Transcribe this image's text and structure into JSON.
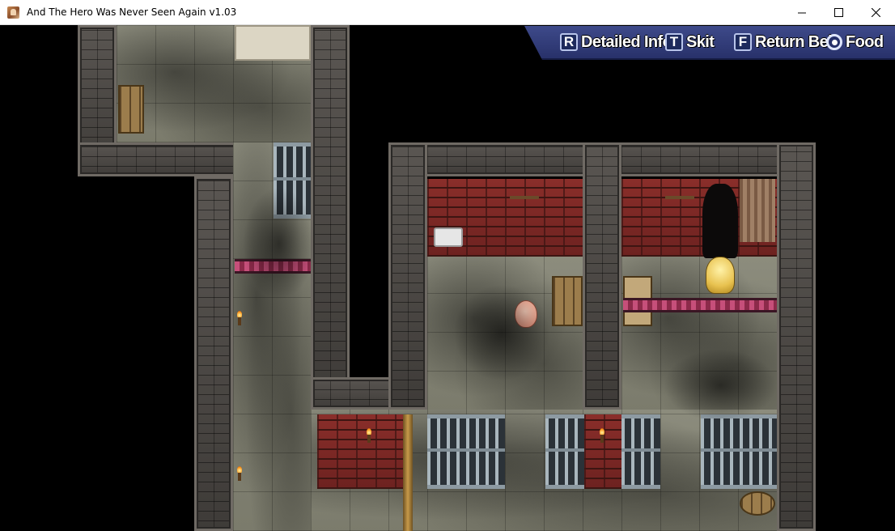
{
  "window": {
    "title": "And The Hero Was Never Seen Again v1.03",
    "controls": [
      "minimize",
      "maximize",
      "close"
    ]
  },
  "hud": {
    "items": [
      {
        "key": "R",
        "label": "Detailed Info"
      },
      {
        "key": "T",
        "label": "Skit"
      },
      {
        "key": "F",
        "label": "Return Bell"
      },
      {
        "icon": "radio-icon",
        "label": "Food"
      }
    ]
  },
  "colors": {
    "hud_bg": "#2f3a78",
    "brick": "#8a2e2a",
    "floor": "#858576",
    "wall": "#4a4743"
  }
}
